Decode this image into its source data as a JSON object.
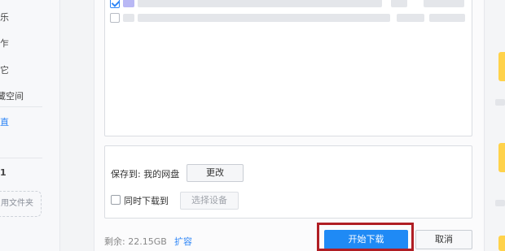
{
  "sidebar": {
    "items": [
      {
        "label": "乐",
        "active": false
      },
      {
        "label": "乍",
        "active": false
      },
      {
        "label": "它",
        "active": false
      },
      {
        "label": "藏空间",
        "active": false
      },
      {
        "label": "直",
        "active": true
      },
      {
        "label": "1",
        "active": false
      }
    ],
    "folder_button": "用文件夹"
  },
  "file_list": {
    "rows": [
      {
        "checked": true
      },
      {
        "checked": false
      }
    ]
  },
  "save_location": {
    "label": "保存到: 我的网盘",
    "change_button": "更改"
  },
  "sync_download": {
    "label": "同时下载到",
    "checked": false,
    "select_device_button": "选择设备"
  },
  "footer": {
    "remaining_space": "剩余: 22.15GB",
    "expand_link": "扩容",
    "start_button": "开始下载",
    "cancel_button": "取消"
  },
  "colors": {
    "accent": "#1f8af5",
    "highlight_border": "#b01e24",
    "folder_yellow": "#ffd24a"
  }
}
